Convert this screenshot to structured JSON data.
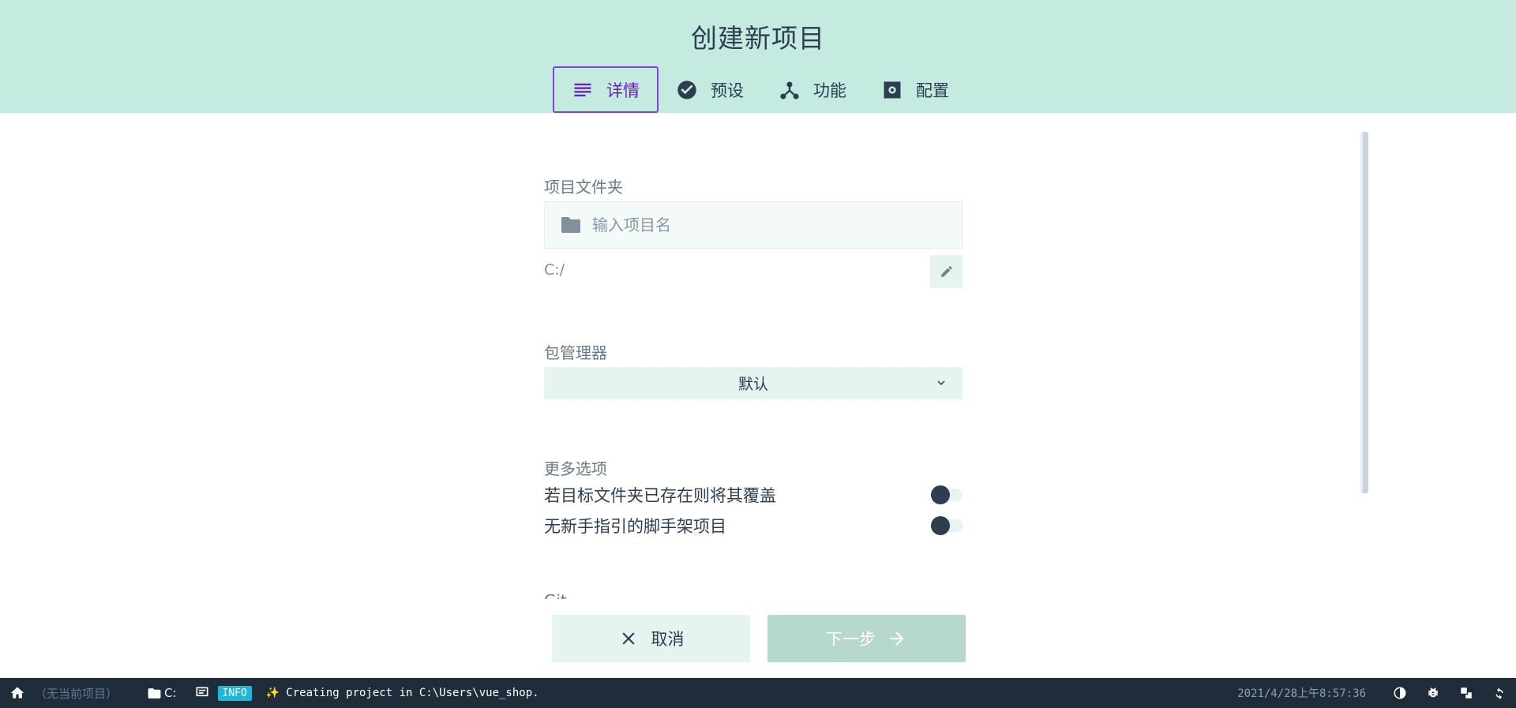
{
  "header": {
    "title": "创建新项目",
    "tabs": [
      {
        "label": "详情",
        "icon": "list-icon",
        "active": true
      },
      {
        "label": "预设",
        "icon": "check-circle-icon",
        "active": false
      },
      {
        "label": "功能",
        "icon": "fork-icon",
        "active": false
      },
      {
        "label": "配置",
        "icon": "gear-icon",
        "active": false
      }
    ]
  },
  "form": {
    "folder_label": "项目文件夹",
    "name_placeholder": "输入项目名",
    "name_value": "",
    "path": "C:/",
    "pm_label": "包管理器",
    "pm_value": "默认",
    "more_label": "更多选项",
    "options": [
      {
        "label": "若目标文件夹已存在则将其覆盖",
        "enabled": false
      },
      {
        "label": "无新手指引的脚手架项目",
        "enabled": false
      }
    ],
    "git_label": "Git"
  },
  "actions": {
    "cancel_label": "取消",
    "next_label": "下一步"
  },
  "statusbar": {
    "project": "（无当前项目）",
    "folder": "C:",
    "log_level": "INFO",
    "message": "Creating project in C:\\Users\\vue_shop.",
    "time": "2021/4/28上午8:57:36"
  },
  "colors": {
    "header_bg": "#c5ebe0",
    "accent": "#6a1fb8",
    "statusbar_bg": "#1f2d3a",
    "info_badge": "#1fb7d6"
  }
}
